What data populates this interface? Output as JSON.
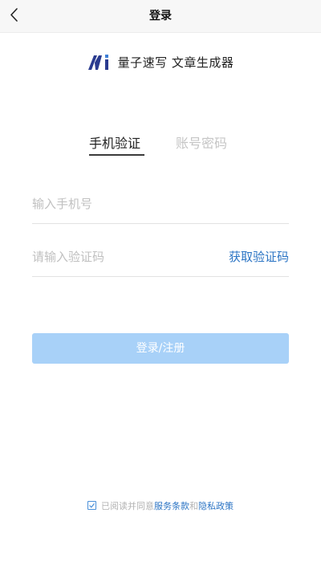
{
  "header": {
    "title": "登录",
    "back_icon": "chevron-left-icon"
  },
  "brand": {
    "name": "量子速写 文章生成器",
    "logo_icon": "brand-logo-icon",
    "logo_color": "#2a3b8f"
  },
  "tabs": [
    {
      "label": "手机验证",
      "active": true
    },
    {
      "label": "账号密码",
      "active": false
    }
  ],
  "form": {
    "phone_placeholder": "输入手机号",
    "code_placeholder": "请输入验证码",
    "get_code_label": "获取验证码",
    "submit_label": "登录/注册"
  },
  "agreement": {
    "prefix": "已阅读并同意",
    "terms_label": "服务条款",
    "conjunction": "和",
    "privacy_label": "隐私政策",
    "checked": true
  },
  "colors": {
    "accent": "#2b74c4",
    "button_bg": "#a8d1f8",
    "placeholder": "#c0c0c0",
    "inactive_tab": "#c5c5c5"
  }
}
